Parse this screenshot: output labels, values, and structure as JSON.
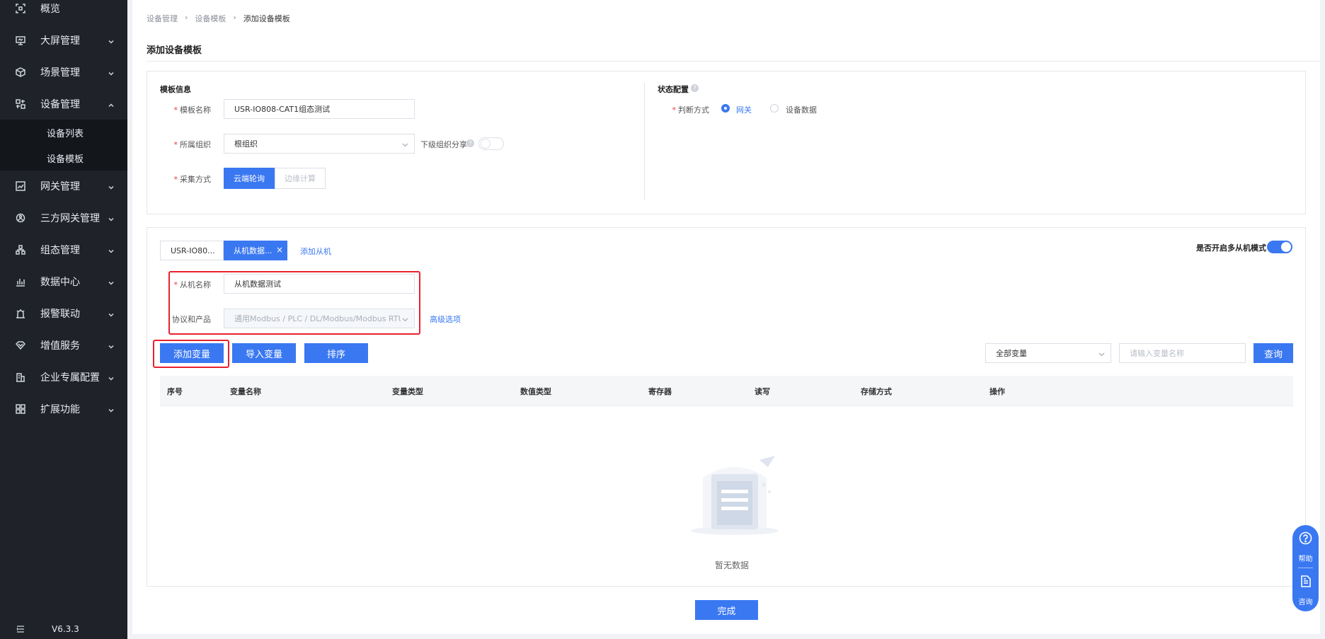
{
  "sidebar": {
    "items": [
      {
        "label": "概览",
        "icon": "overview-icon"
      },
      {
        "label": "大屏管理",
        "icon": "screen-icon"
      },
      {
        "label": "场景管理",
        "icon": "scene-icon"
      },
      {
        "label": "设备管理",
        "icon": "device-icon"
      },
      {
        "label": "网关管理",
        "icon": "gateway-icon"
      },
      {
        "label": "三方网关管理",
        "icon": "third-party-icon"
      },
      {
        "label": "组态管理",
        "icon": "config-icon"
      },
      {
        "label": "数据中心",
        "icon": "data-icon"
      },
      {
        "label": "报警联动",
        "icon": "alarm-icon"
      },
      {
        "label": "增值服务",
        "icon": "vip-icon"
      },
      {
        "label": "企业专属配置",
        "icon": "enterprise-icon"
      },
      {
        "label": "扩展功能",
        "icon": "extend-icon"
      }
    ],
    "sub_items": [
      "设备列表",
      "设备模板"
    ],
    "version": "V6.3.3"
  },
  "breadcrumb": [
    "设备管理",
    "设备模板",
    "添加设备模板"
  ],
  "page_title": "添加设备模板",
  "template_info": {
    "title": "模板信息",
    "name_label": "模板名称",
    "name_value": "USR-IO808-CAT1组态测试",
    "org_label": "所属组织",
    "org_value": "根组织",
    "share_label": "下级组织分享",
    "share_on": false,
    "collect_label": "采集方式",
    "collect_options": [
      "云端轮询",
      "边缘计算"
    ]
  },
  "status_config": {
    "title": "状态配置",
    "judge_label": "判断方式",
    "options": [
      "网关",
      "设备数据"
    ],
    "selected": "网关"
  },
  "slave": {
    "tabs": [
      "USR-IO80...",
      "从机数据..."
    ],
    "add_slave": "添加从机",
    "multi_mode_label": "是否开启多从机模式",
    "multi_mode_on": true,
    "name_label": "从机名称",
    "name_value": "从机数据测试",
    "protocol_label": "协议和产品",
    "protocol_value": "通用Modbus / PLC / DL/Modbus/Modbus RTU",
    "advanced": "高级选项"
  },
  "toolbar": {
    "add_var": "添加变量",
    "import_var": "导入变量",
    "sort": "排序",
    "filter_value": "全部变量",
    "search_placeholder": "请输入变量名称",
    "query": "查询"
  },
  "table": {
    "columns": [
      "序号",
      "变量名称",
      "变量类型",
      "数值类型",
      "寄存器",
      "读写",
      "存储方式",
      "操作"
    ],
    "empty_text": "暂无数据"
  },
  "finish": "完成",
  "float_help": {
    "help": "帮助",
    "consult": "咨询"
  },
  "colors": {
    "primary": "#3a78f2",
    "sidebar": "#1f2329",
    "highlight": "#e8222e"
  }
}
